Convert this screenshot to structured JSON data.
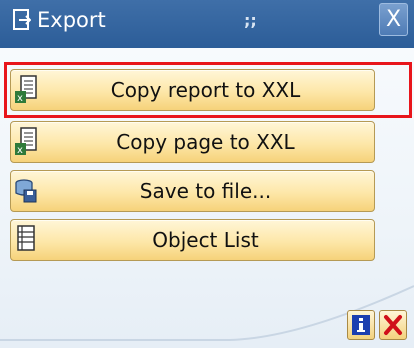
{
  "window": {
    "title": "Export",
    "grip": ";;",
    "close_glyph": "X",
    "title_icon": "export-icon"
  },
  "buttons": [
    {
      "label": "Copy report to XXL",
      "icon": "spreadsheet-xxl-icon",
      "focused": true
    },
    {
      "label": "Copy page to XXL",
      "icon": "spreadsheet-xxl-icon",
      "focused": false
    },
    {
      "label": "Save to file...",
      "icon": "save-to-file-icon",
      "focused": false
    },
    {
      "label": "Object List",
      "icon": "object-list-icon",
      "focused": false
    }
  ],
  "footer": {
    "info_icon": "info-icon",
    "cancel_icon": "cancel-icon"
  },
  "colors": {
    "titlebar": "#2c5d98",
    "button_fill": "#fde7a8",
    "focus_frame": "#e8151b",
    "cancel_red": "#d0101a",
    "info_blue": "#1c3fb0"
  }
}
